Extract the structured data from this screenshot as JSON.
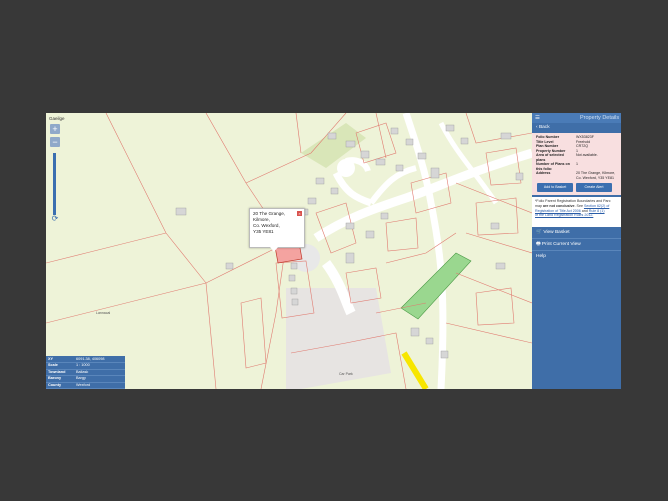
{
  "map": {
    "language_link": "Gaeilge",
    "zoom_in": "+",
    "zoom_out": "−",
    "refresh_icon": "⟳",
    "labels": {
      "townland": "Lannacal",
      "car_park": "Car Park"
    },
    "popup": {
      "line1": "20 The Grange,",
      "line2": "Kilmore,",
      "line3": "Co. Wexford,",
      "line4": "Y35 YE81",
      "close": "×"
    },
    "info_panel": {
      "xy_label": "XY",
      "xy_value": "6091.38, 406098",
      "scale_label": "Scale",
      "scale_value": "1 : 1000",
      "townland_label": "Townland",
      "townland_value": "Ballask",
      "barony_label": "Barony",
      "barony_value": "Bargy",
      "county_label": "County",
      "county_value": "Wexford"
    },
    "colors": {
      "background": "#eef3d8",
      "boundary": "#e07a70",
      "road": "#ffffff",
      "selected": "#f4a3a0",
      "woodland": "#8ed08a",
      "highlight_road": "#f7e600"
    }
  },
  "sidebar": {
    "menu_icon": "☰",
    "title": "Property Details",
    "back_label": "Back",
    "details": {
      "folio_label": "Folio Number",
      "folio_value": "WX53823F",
      "title_label": "Title Level",
      "title_value": "Freehold",
      "plan_label": "Plan Number",
      "plan_value": "CR72Q",
      "property_label": "Property Number",
      "property_value": "1",
      "area_label": "Area of selected plans",
      "area_value": "Not available.",
      "plans_label": "Number of Plans on this folio:",
      "plans_value": "1",
      "address_label": "Address",
      "address_value": "20 The Grange, Kilmore, Co. Wexford, Y35 YE81"
    },
    "add_basket": "Add to Basket",
    "create_alert": "Create Alert",
    "note_line1": "*Folio Parent Registration Boundaries and Parc",
    "note_line2a": "map ",
    "note_line2b": "are not conclusive",
    "note_line2c": ". See ",
    "note_link1": "Section 62(2) of",
    "note_link2": "Registration of Title Act 2006",
    "note_line3b": " and ",
    "note_link3": "Rule 8 (1)",
    "note_link4": "of the Land Registration Rules 2012.",
    "menu": [
      {
        "icon": "🛒",
        "label": "View Basket"
      },
      {
        "icon": "🖶",
        "label": "Print Current View"
      },
      {
        "icon": "",
        "label": "Help"
      }
    ]
  }
}
